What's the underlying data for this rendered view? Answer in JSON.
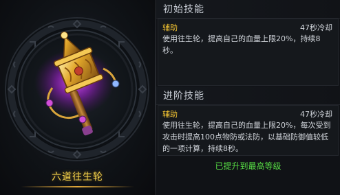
{
  "item": {
    "name": "六道往生轮",
    "icon": "prayer-wheel-icon",
    "colors": {
      "name": "#f0cf4a",
      "glow": "#b02ed8"
    }
  },
  "skills": {
    "initial": {
      "title": "初始技能",
      "type": "辅助",
      "cooldown": "47秒冷却",
      "description": "使用往生轮，提高自己的血量上限20%，持续8秒。"
    },
    "advanced": {
      "title": "进阶技能",
      "type": "辅助",
      "cooldown": "47秒冷却",
      "description": "使用往生轮，提高自己的血量上限20%，每次受到攻击时提高100点物防或法防，以基础防御值较低的一项计算，持续8秒。"
    }
  },
  "status": {
    "max_level_text": "已提升到最高等级",
    "color": "#55d943"
  }
}
